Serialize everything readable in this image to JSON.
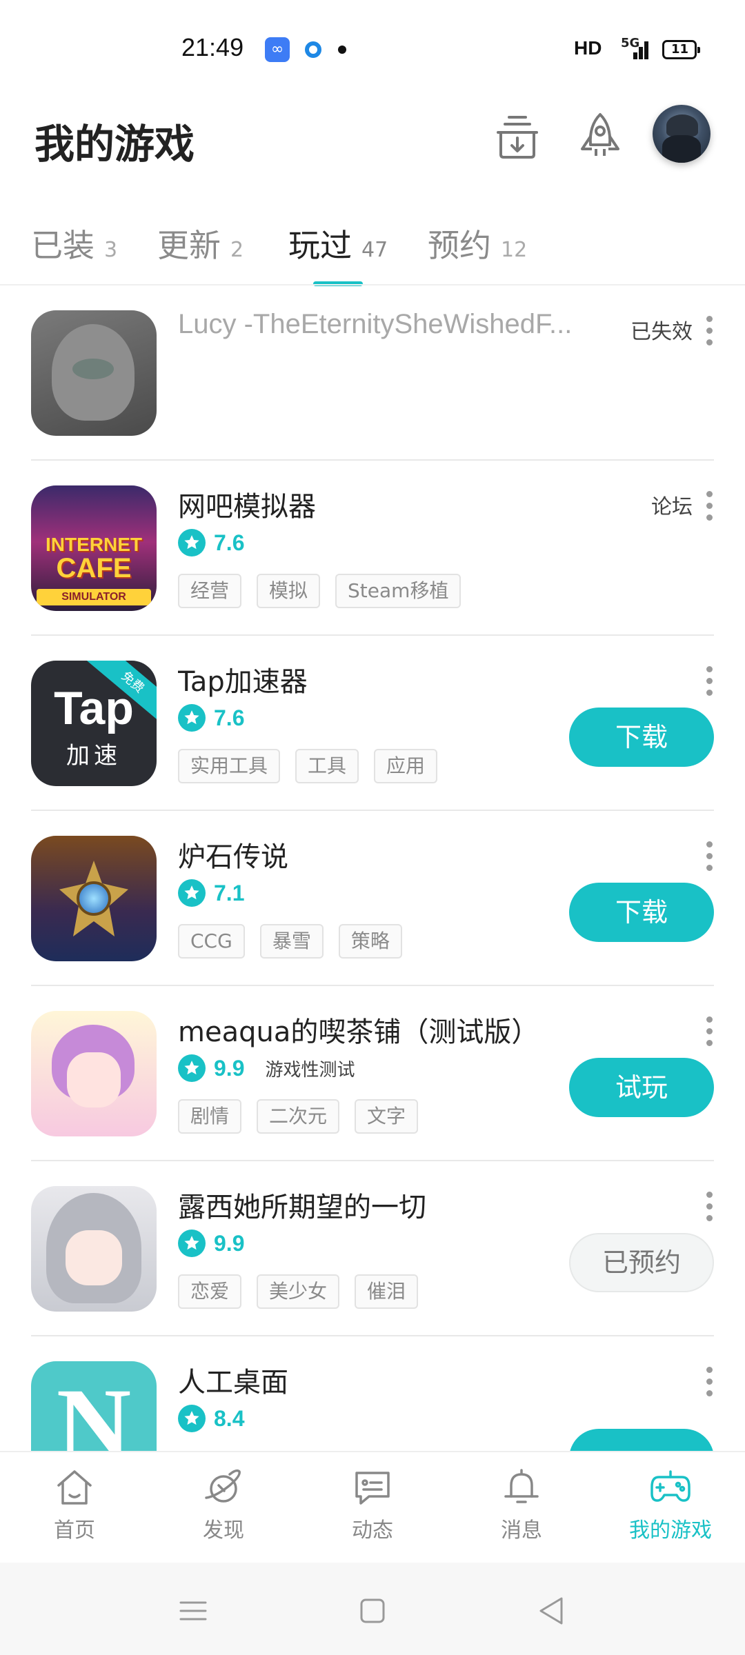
{
  "status_bar": {
    "time": "21:49",
    "network": "HD",
    "signal": "5G",
    "battery": "11",
    "app_icon_glyph": "∞"
  },
  "header": {
    "title": "我的游戏",
    "icons": [
      "download-manager-icon",
      "rocket-icon",
      "avatar"
    ]
  },
  "tabs": [
    {
      "label": "已装",
      "count": "3"
    },
    {
      "label": "更新",
      "count": "2"
    },
    {
      "label": "玩过",
      "count": "47",
      "active": true
    },
    {
      "label": "预约",
      "count": "12"
    }
  ],
  "games": [
    {
      "name": "Lucy -TheEternitySheWishedF...",
      "status": "已失效"
    },
    {
      "name": "网吧模拟器",
      "rating": "7.6",
      "tags": [
        "经营",
        "模拟",
        "Steam移植"
      ],
      "side_link": "论坛",
      "icon_text": {
        "line1": "INTERNET",
        "line2": "CAFE",
        "line3": "SIMULATOR"
      }
    },
    {
      "name": "Tap加速器",
      "rating": "7.6",
      "tags": [
        "实用工具",
        "工具",
        "应用"
      ],
      "button": "下载",
      "icon_text": {
        "big": "Tap",
        "small": "加速",
        "ribbon": "免费"
      }
    },
    {
      "name": "炉石传说",
      "rating": "7.1",
      "tags": [
        "CCG",
        "暴雪",
        "策略"
      ],
      "button": "下载"
    },
    {
      "name": "meaqua的喫茶铺（测试版）",
      "rating": "9.9",
      "note": "游戏性测试",
      "tags": [
        "剧情",
        "二次元",
        "文字"
      ],
      "button": "试玩"
    },
    {
      "name": "露西她所期望的一切",
      "rating": "9.9",
      "tags": [
        "恋爱",
        "美少女",
        "催泪"
      ],
      "button": "已预约"
    },
    {
      "name": "人工桌面",
      "rating": "8.4",
      "icon_text": {
        "big": "N"
      }
    }
  ],
  "bottom_nav": [
    {
      "label": "首页",
      "icon": "home-icon"
    },
    {
      "label": "发现",
      "icon": "discover-planet-icon"
    },
    {
      "label": "动态",
      "icon": "feed-chat-icon"
    },
    {
      "label": "消息",
      "icon": "bell-icon"
    },
    {
      "label": "我的游戏",
      "icon": "gamepad-icon",
      "active": true
    }
  ],
  "colors": {
    "accent": "#19c1c6",
    "text": "#222222",
    "muted": "#8a8a8a"
  }
}
